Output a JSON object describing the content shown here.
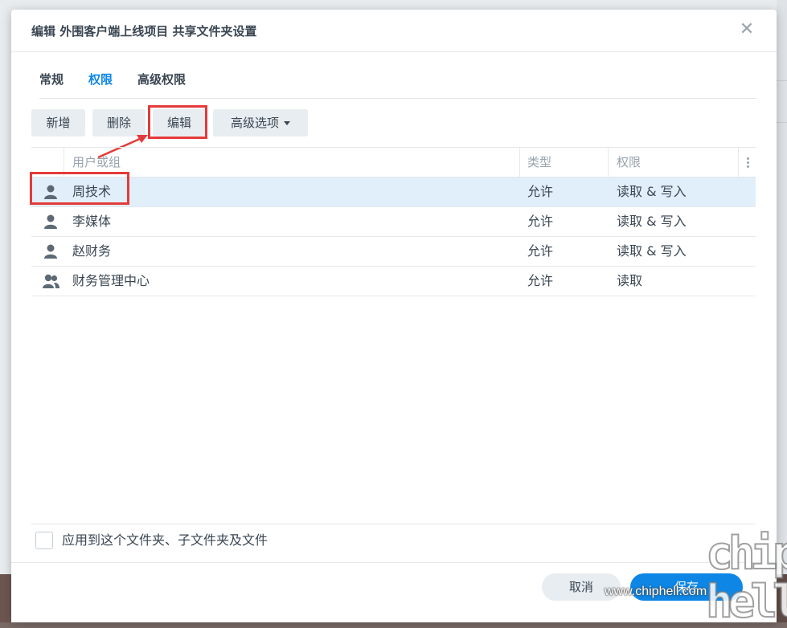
{
  "dialog": {
    "title": "编辑 外围客户端上线项目 共享文件夹设置",
    "close_glyph": "✕"
  },
  "tabs": [
    {
      "label": "常规"
    },
    {
      "label": "权限",
      "active": true
    },
    {
      "label": "高级权限"
    }
  ],
  "toolbar": {
    "add_label": "新增",
    "delete_label": "删除",
    "edit_label": "编辑",
    "advanced_label": "高级选项"
  },
  "grid": {
    "headers": {
      "name": "用户或组",
      "type": "类型",
      "permission": "权限"
    },
    "rows": [
      {
        "icon": "user-icon",
        "name": "周技术",
        "type": "允许",
        "permission": "读取 & 写入",
        "selected": true
      },
      {
        "icon": "user-icon",
        "name": "李媒体",
        "type": "允许",
        "permission": "读取 & 写入"
      },
      {
        "icon": "user-icon",
        "name": "赵财务",
        "type": "允许",
        "permission": "读取 & 写入"
      },
      {
        "icon": "group-icon",
        "name": "财务管理中心",
        "type": "允许",
        "permission": "读取"
      }
    ]
  },
  "footer": {
    "apply_checkbox_label": "应用到这个文件夹、子文件夹及文件",
    "cancel_label": "取消",
    "save_label": "保存"
  },
  "watermark": {
    "logo": "chip hell",
    "url": "www.chiphell.com"
  },
  "colors": {
    "accent": "#0d86e6",
    "selected_row": "#e1effb",
    "highlight_annotation": "#e53a3a"
  }
}
